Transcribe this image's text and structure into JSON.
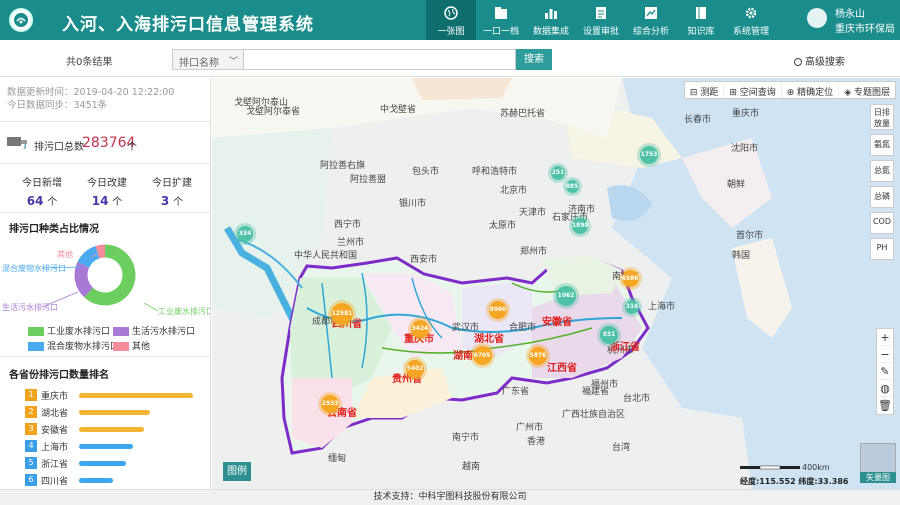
{
  "header": {
    "title": "入河、入海排污口信息管理系统",
    "nav": [
      {
        "label": "一张图",
        "icon": "globe-icon",
        "active": true
      },
      {
        "label": "一口一档",
        "icon": "folder-icon"
      },
      {
        "label": "数据集成",
        "icon": "chart-icon"
      },
      {
        "label": "设置审批",
        "icon": "document-icon"
      },
      {
        "label": "综合分析",
        "icon": "analysis-icon"
      },
      {
        "label": "知识库",
        "icon": "book-icon"
      },
      {
        "label": "系统管理",
        "icon": "gear-icon"
      }
    ],
    "user": {
      "name": "杨永山",
      "org": "重庆市环保局"
    }
  },
  "search": {
    "result_count": "共0条结果",
    "type_value": "排口名称",
    "input_placeholder": "",
    "button_label": "搜索",
    "advanced_label": "高级搜索"
  },
  "sidebar": {
    "update_time": "数据更新时间：2019-04-20 12:22:00",
    "today_sync": "今日数据同步：3451条",
    "total_label": "排污口总数",
    "total_value": "283764",
    "total_unit": "个",
    "today": [
      {
        "label": "今日新增",
        "value": "64",
        "unit": "个"
      },
      {
        "label": "今日改建",
        "value": "14",
        "unit": "个"
      },
      {
        "label": "今日扩建",
        "value": "3",
        "unit": "个"
      }
    ],
    "pie": {
      "title": "排污口种类占比情况",
      "slices": [
        {
          "name": "工业废水排污口",
          "share": 0.62,
          "color": "#6cce5e"
        },
        {
          "name": "生活污水排污口",
          "share": 0.2,
          "color": "#a97ad5"
        },
        {
          "name": "混合废物水排污口",
          "share": 0.13,
          "color": "#4aa9ef"
        },
        {
          "name": "其他",
          "share": 0.05,
          "color": "#f68b9b"
        }
      ]
    },
    "ranking": {
      "title": "各省份排污口数量排名",
      "items": [
        {
          "rank": "1",
          "name": "重庆市",
          "share": 1.0
        },
        {
          "rank": "2",
          "name": "湖北省",
          "share": 0.62
        },
        {
          "rank": "3",
          "name": "安徽省",
          "share": 0.57
        },
        {
          "rank": "4",
          "name": "上海市",
          "share": 0.47
        },
        {
          "rank": "5",
          "name": "浙江省",
          "share": 0.41
        },
        {
          "rank": "6",
          "name": "四川省",
          "share": 0.3
        }
      ]
    }
  },
  "map": {
    "tools": [
      "测距",
      "空间查询",
      "精确定位",
      "专题图层"
    ],
    "layers": [
      "日排放量",
      "氨氮",
      "总氮",
      "总磷",
      "COD",
      "PH"
    ],
    "places": [
      "戈壁阿尔泰山",
      "戈壁阿尔泰省",
      "中戈壁省",
      "苏赫巴托省",
      "长春市",
      "重庆市",
      "沈阳市",
      "朝鲜",
      "阿拉善右旗",
      "阿拉善盟",
      "包头市",
      "呼和浩特市",
      "北京市",
      "天津市",
      "银川市",
      "太原市",
      "石家庄市",
      "济南市",
      "西宁市",
      "兰州市",
      "中华人民共和国",
      "郑州市",
      "西安市",
      "南京市",
      "首尔市",
      "韩国",
      "成都市",
      "武汉市",
      "合肥市",
      "上海市",
      "杭州市",
      "四川省",
      "重庆市",
      "湖北省",
      "安徽省",
      "湖南省",
      "贵州省",
      "江西省",
      "浙江省",
      "云南省",
      "福州市",
      "台北市",
      "广州市",
      "南宁市",
      "香港",
      "越南",
      "缅甸",
      "广西壮族自治区",
      "广东省",
      "福建省",
      "台湾"
    ],
    "clusters": [
      {
        "count": "334"
      },
      {
        "count": "1753"
      },
      {
        "count": "251"
      },
      {
        "count": "885"
      },
      {
        "count": "1898"
      },
      {
        "count": "12581"
      },
      {
        "count": "3424"
      },
      {
        "count": "8060"
      },
      {
        "count": "1062"
      },
      {
        "count": "6586"
      },
      {
        "count": "316"
      },
      {
        "count": "931"
      },
      {
        "count": "5402"
      },
      {
        "count": "6705"
      },
      {
        "count": "5876"
      },
      {
        "count": "2933"
      }
    ],
    "legend_label": "图例",
    "scale_label": "400km",
    "coords": "经度:115.552 纬度:33.386",
    "basemap_label": "矢量图"
  },
  "footer": "技术支持：中科宇图科技股份有限公司"
}
